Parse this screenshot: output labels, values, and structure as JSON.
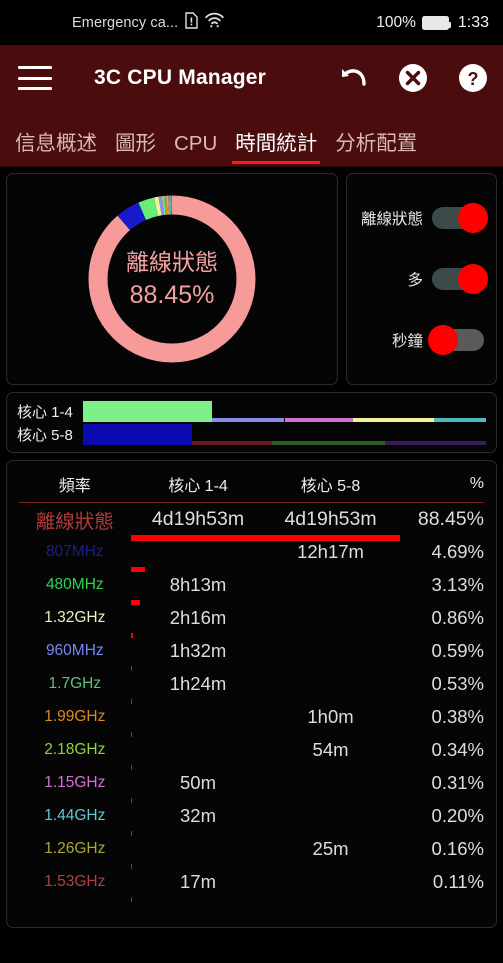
{
  "statusbar": {
    "carrier": "Emergency ca...",
    "sim_icon": "sim-alert-icon",
    "wifi_icon": "wifi-icon",
    "battery_percent": "100%",
    "battery_icon": "battery-full-icon",
    "time": "1:33"
  },
  "appbar": {
    "menu_icon": "hamburger-menu-icon",
    "title": "3C CPU Manager",
    "undo_icon": "undo-arrow-icon",
    "close_icon": "close-circle-icon",
    "help_icon": "help-circle-icon",
    "background": "#4a0c0c"
  },
  "tabs": {
    "active_index": 3,
    "accent": "#ff1a1a",
    "items": [
      {
        "label": "信息概述"
      },
      {
        "label": "圖形"
      },
      {
        "label": "CPU"
      },
      {
        "label": "時間統計"
      },
      {
        "label": "分析配置"
      }
    ]
  },
  "donut": {
    "center_label": "離線狀態",
    "center_value": "88.45%",
    "center_color": "#f4a0a0"
  },
  "toggles": [
    {
      "label": "離線狀態",
      "state": "on",
      "on_color": "#ff0000"
    },
    {
      "label": "多",
      "state": "on",
      "on_color": "#ff0000"
    },
    {
      "label": "秒鐘",
      "state": "off",
      "on_color": "#ff0000"
    }
  ],
  "cores": [
    {
      "label": "核心 1-4"
    },
    {
      "label": "核心 5-8"
    }
  ],
  "table": {
    "headers": {
      "freq": "頻率",
      "core14": "核心 1-4",
      "core58": "核心 5-8",
      "pct": "%"
    },
    "rows": [
      {
        "freq": "離線狀態",
        "color": "#b03a3a",
        "core14": "4d19h53m",
        "core58": "4d19h53m",
        "pct": "88.45%",
        "bar": 88.45
      },
      {
        "freq": "807MHz",
        "color": "#1c1c8c",
        "core14": "",
        "core58": "12h17m",
        "pct": "4.69%",
        "bar": 4.69
      },
      {
        "freq": "480MHz",
        "color": "#2fd44f",
        "core14": "8h13m",
        "core58": "",
        "pct": "3.13%",
        "bar": 3.13
      },
      {
        "freq": "1.32GHz",
        "color": "#efefbe",
        "core14": "2h16m",
        "core58": "",
        "pct": "0.86%",
        "bar": 0.86
      },
      {
        "freq": "960MHz",
        "color": "#7a85f0",
        "core14": "1h32m",
        "core58": "",
        "pct": "0.59%",
        "bar": 0.59
      },
      {
        "freq": "1.7GHz",
        "color": "#5fbf7a",
        "core14": "1h24m",
        "core58": "",
        "pct": "0.53%",
        "bar": 0.53
      },
      {
        "freq": "1.99GHz",
        "color": "#d98a22",
        "core14": "",
        "core58": "1h0m",
        "pct": "0.38%",
        "bar": 0.38
      },
      {
        "freq": "2.18GHz",
        "color": "#8fd43a",
        "core14": "",
        "core58": "54m",
        "pct": "0.34%",
        "bar": 0.34
      },
      {
        "freq": "1.15GHz",
        "color": "#d46fd4",
        "core14": "50m",
        "core58": "",
        "pct": "0.31%",
        "bar": 0.31
      },
      {
        "freq": "1.44GHz",
        "color": "#5fc8d4",
        "core14": "32m",
        "core58": "",
        "pct": "0.20%",
        "bar": 0.2
      },
      {
        "freq": "1.26GHz",
        "color": "#a8a832",
        "core14": "",
        "core58": "25m",
        "pct": "0.16%",
        "bar": 0.16
      },
      {
        "freq": "1.53GHz",
        "color": "#b04040",
        "core14": "17m",
        "core58": "",
        "pct": "0.11%",
        "bar": 0.11
      }
    ]
  },
  "chart_data": [
    {
      "type": "pie",
      "title": "離線狀態 88.45%",
      "subtitle": "CPU frequency time distribution (donut)",
      "categories": [
        "離線狀態",
        "807MHz",
        "480MHz",
        "1.32GHz",
        "960MHz",
        "1.7GHz",
        "1.99GHz",
        "2.18GHz",
        "1.15GHz",
        "1.44GHz",
        "1.26GHz",
        "1.53GHz"
      ],
      "values": [
        88.45,
        4.69,
        3.13,
        0.86,
        0.59,
        0.53,
        0.38,
        0.34,
        0.31,
        0.2,
        0.16,
        0.11
      ],
      "colors": [
        "#f79a9a",
        "#1a1acd",
        "#66ee77",
        "#f2f29a",
        "#8a93f0",
        "#7fd489",
        "#d98a22",
        "#9ad43a",
        "#d46fd4",
        "#5fc8d4",
        "#a8a832",
        "#c05050"
      ],
      "legend": "none",
      "units": "%"
    },
    {
      "type": "bar",
      "title": "核心 1-4 frequency usage strip",
      "orientation": "horizontal-stacked",
      "categories": [
        "480MHz",
        "960MHz",
        "1.15GHz",
        "1.32GHz",
        "1.44GHz"
      ],
      "values": [
        32,
        18,
        17,
        20,
        13
      ],
      "colors": [
        "#7ef08a",
        "#8a8ae8",
        "#d46fd4",
        "#f2f09a",
        "#4fb8c0"
      ],
      "ylabel": "核心 1-4"
    },
    {
      "type": "bar",
      "title": "核心 5-8 frequency usage strip",
      "orientation": "horizontal-stacked",
      "categories": [
        "807MHz",
        "1.26GHz",
        "1.99GHz",
        "2.18GHz"
      ],
      "values": [
        27,
        20,
        28,
        25
      ],
      "colors": [
        "#0a0ab0",
        "#6a1a1a",
        "#2a5a2a",
        "#3a1a5a"
      ],
      "ylabel": "核心 5-8"
    },
    {
      "type": "table",
      "title": "頻率時間統計",
      "columns": [
        "頻率",
        "核心 1-4",
        "核心 5-8",
        "%"
      ],
      "rows": [
        [
          "離線狀態",
          "4d19h53m",
          "4d19h53m",
          "88.45%"
        ],
        [
          "807MHz",
          "",
          "12h17m",
          "4.69%"
        ],
        [
          "480MHz",
          "8h13m",
          "",
          "3.13%"
        ],
        [
          "1.32GHz",
          "2h16m",
          "",
          "0.86%"
        ],
        [
          "960MHz",
          "1h32m",
          "",
          "0.59%"
        ],
        [
          "1.7GHz",
          "1h24m",
          "",
          "0.53%"
        ],
        [
          "1.99GHz",
          "",
          "1h0m",
          "0.38%"
        ],
        [
          "2.18GHz",
          "",
          "54m",
          "0.34%"
        ],
        [
          "1.15GHz",
          "50m",
          "",
          "0.31%"
        ],
        [
          "1.44GHz",
          "32m",
          "",
          "0.20%"
        ],
        [
          "1.26GHz",
          "",
          "25m",
          "0.16%"
        ],
        [
          "1.53GHz",
          "17m",
          "",
          "0.11%"
        ]
      ]
    }
  ]
}
